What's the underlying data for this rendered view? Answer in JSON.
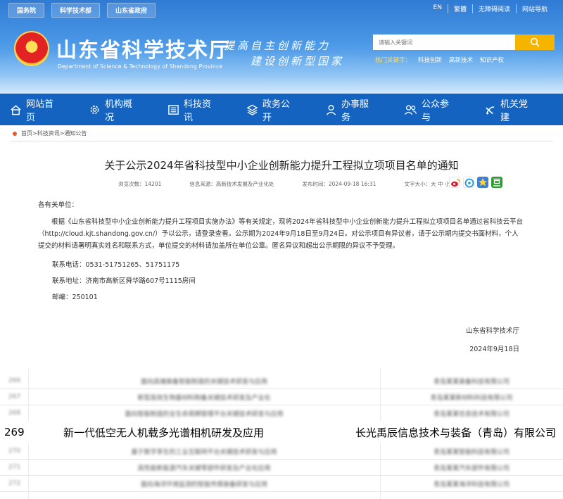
{
  "header": {
    "top_links": [
      "国务院",
      "科学技术部",
      "山东省政府"
    ],
    "lang_links": [
      "EN",
      "繁體",
      "无障碍阅读",
      "网站导航"
    ],
    "site_title": "山东省科学技术厅",
    "site_subtitle": "Department of Science & Technology of Shandong Province",
    "slogan_line1": "提高自主创新能力",
    "slogan_line2": "建设创新型国家",
    "search_placeholder": "请输入关键词",
    "hot_label": "热门关键字：",
    "hot_words": [
      "科技创新",
      "高新技术",
      "知识产权"
    ]
  },
  "nav": [
    "网站首页",
    "机构概况",
    "科技资讯",
    "政务公开",
    "办事服务",
    "公众参与",
    "机关党建"
  ],
  "breadcrumb": "首页>科技资讯>通知公告",
  "article": {
    "title": "关于公示2024年省科技型中小企业创新能力提升工程拟立项项目名单的通知",
    "views": "浏览次数：14201",
    "source": "信息来源：高新技术发展及产业化处",
    "date": "发布时间：2024-09-18 16:31",
    "font_size": "文字大小：大 中 小",
    "salutation": "各有关单位：",
    "paragraph": "根据《山东省科技型中小企业创新能力提升工程项目实施办法》等有关规定，现将2024年省科技型中小企业创新能力提升工程拟立项项目名单通过省科技云平台（http://cloud.kjt.shandong.gov.cn/）予以公示，请登录查看。公示期为2024年9月18日至9月24日。对公示项目有异议者，请于公示期内提交书面材料，个人提交的材料请署明真实姓名和联系方式，单位提交的材料请加盖所在单位公章。匿名异议和超出公示期限的异议不予受理。",
    "phone": "联系电话：0531-51751265、51751175",
    "address": "联系地址：济南市高新区舜华路607号1115房间",
    "zip": "邮编：250101",
    "signer": "山东省科学技术厅",
    "sign_date": "2024年9月18日"
  },
  "table": {
    "rows": [
      {
        "num": "266",
        "name": "面向高端装备智能制造的关键技术研发与应用",
        "org": "青岛某某装备科技有限公司"
      },
      {
        "num": "267",
        "name": "新型高效生物基材料制备关键技术研发及产业化",
        "org": "青岛某某新材料科技有限公司"
      },
      {
        "num": "268",
        "name": "面向智能制造的全生命周期管理平台关键技术研发与应用",
        "org": "青岛某某信息技术有限公司"
      },
      {
        "num": "269",
        "name": "新一代低空无人机载多光谱相机研发及应用",
        "org": "长光禹辰信息技术与装备（青岛）有限公司"
      },
      {
        "num": "270",
        "name": "基于数字孪生的工业互联网平台关键技术研发与应用",
        "org": "青岛某某智能科技有限公司"
      },
      {
        "num": "271",
        "name": "高性能新能源汽车关键零部件研发及产业化应用",
        "org": "青岛某某汽车部件有限公司"
      },
      {
        "num": "272",
        "name": "面向海洋环境监测的智能传感装备研发与应用",
        "org": "青岛某某海洋科技有限公司"
      }
    ]
  },
  "colors": {
    "nav_bg": "#1463c0",
    "search_button": "#f4b400",
    "accent_dot": "#e85a2a"
  }
}
